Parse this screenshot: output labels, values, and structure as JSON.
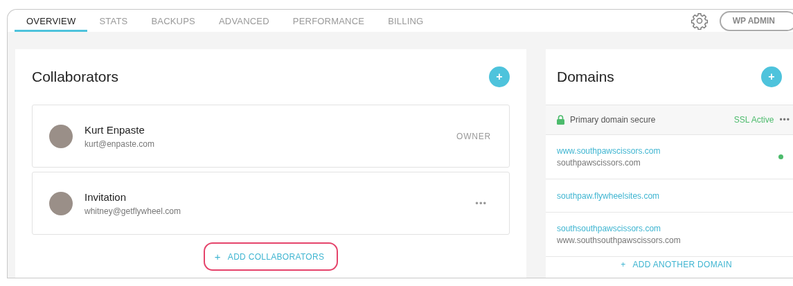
{
  "tabs": [
    {
      "label": "OVERVIEW",
      "selected": true
    },
    {
      "label": "STATS",
      "selected": false
    },
    {
      "label": "BACKUPS",
      "selected": false
    },
    {
      "label": "ADVANCED",
      "selected": false
    },
    {
      "label": "PERFORMANCE",
      "selected": false
    },
    {
      "label": "BILLING",
      "selected": false
    }
  ],
  "header_button": "WP ADMIN",
  "collaborators": {
    "title": "Collaborators",
    "add_icon": "+",
    "items": [
      {
        "kind": "owner",
        "name": "Kurt Enpaste",
        "email": "kurt@enpaste.com",
        "role": "OWNER"
      },
      {
        "kind": "invitation",
        "name": "Invitation",
        "email": "whitney@getflywheel.com",
        "menu": "•••"
      }
    ],
    "add_button": {
      "icon": "+",
      "label": "ADD COLLABORATORS",
      "highlighted": true
    }
  },
  "domains": {
    "title": "Domains",
    "add_icon": "+",
    "primary": {
      "label": "Primary domain secure",
      "status": "SSL Active",
      "menu": "•••"
    },
    "items": [
      {
        "domain": "www.southpawscissors.com",
        "alias": "southpawscissors.com",
        "connected": true
      },
      {
        "domain": "southpaw.flywheelsites.com",
        "connected": false
      },
      {
        "domain": "southsouthpawscissors.com",
        "alias": "www.southsouthpawscissors.com",
        "connected": false
      }
    ],
    "add_button": {
      "icon": "+",
      "label": "ADD ANOTHER DOMAIN"
    }
  }
}
